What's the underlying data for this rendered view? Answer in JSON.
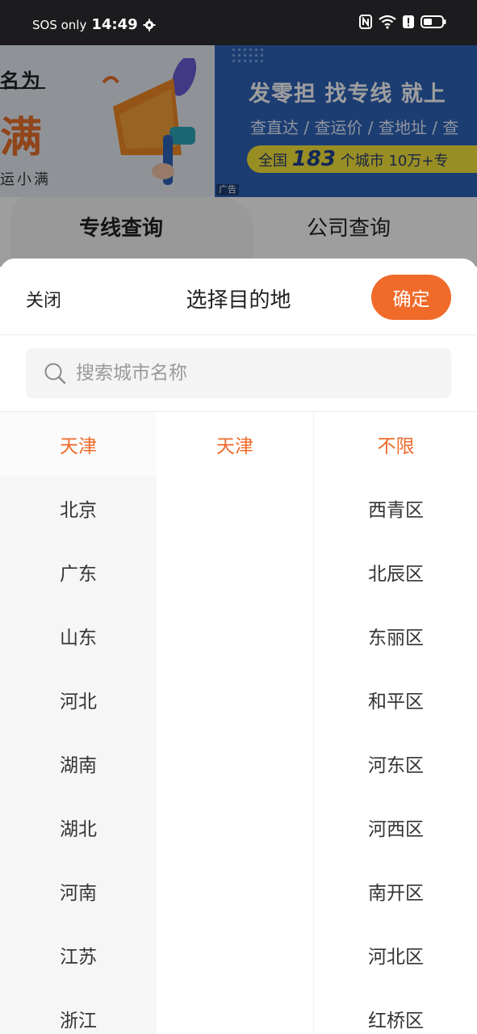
{
  "status_bar": {
    "carrier": "SOS only",
    "time": "14:49"
  },
  "background": {
    "ad_left": {
      "brand_line1": "名为",
      "brand_line2": "满",
      "brand_line3": "运小满"
    },
    "ad_right": {
      "headline": "发零担 找专线 就上",
      "subline": "查直达 / 查运价 / 查地址 / 查",
      "pill_prefix": "全国",
      "pill_number": "183",
      "pill_suffix": "个城市 10万+专"
    },
    "ad_tag": "广告",
    "tabs": [
      {
        "label": "专线查询"
      },
      {
        "label": "公司查询"
      }
    ]
  },
  "sheet": {
    "close_label": "关闭",
    "title": "选择目的地",
    "confirm_label": "确定",
    "search_placeholder": "搜索城市名称"
  },
  "provinces": [
    "天津",
    "北京",
    "广东",
    "山东",
    "河北",
    "湖南",
    "湖北",
    "河南",
    "江苏",
    "浙江"
  ],
  "cities": [
    "天津"
  ],
  "districts": [
    "不限",
    "西青区",
    "北辰区",
    "东丽区",
    "和平区",
    "河东区",
    "河西区",
    "南开区",
    "河北区",
    "红桥区"
  ],
  "colors": {
    "accent": "#f06a2a",
    "left_column_bg": "#f6f6f6"
  }
}
